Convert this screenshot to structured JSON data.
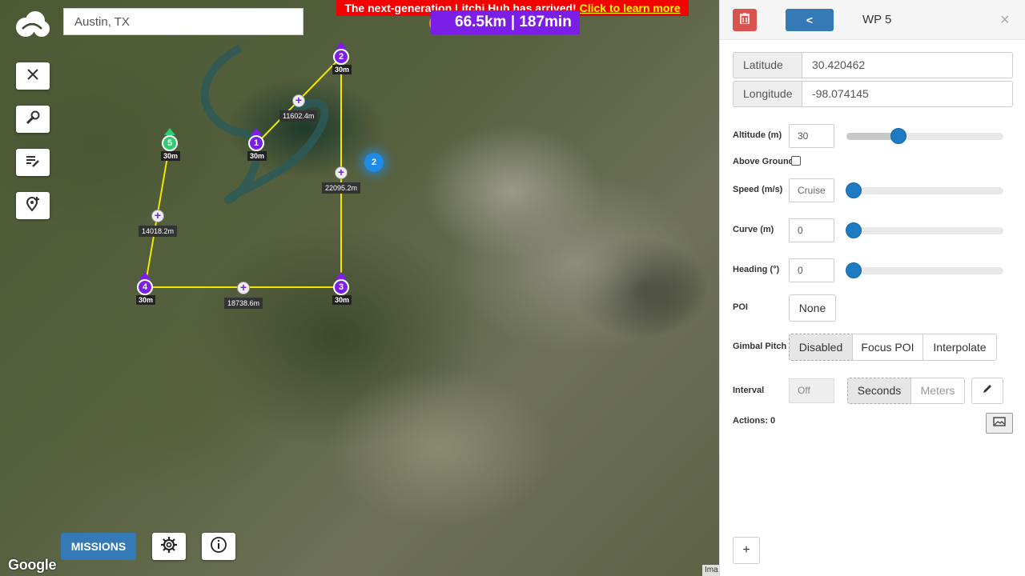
{
  "map": {
    "search_value": "Austin, TX",
    "banner_text": "The next-generation Litchi Hub has arrived! ",
    "banner_link": "Click to learn more",
    "stats": "66.5km | 187min",
    "missions_label": "MISSIONS",
    "google_label": "Google",
    "imagery_label": "Ima",
    "blue_marker": "2",
    "waypoints": [
      {
        "num": "1",
        "alt": "30m"
      },
      {
        "num": "2",
        "alt": "30m"
      },
      {
        "num": "3",
        "alt": "30m"
      },
      {
        "num": "4",
        "alt": "30m"
      },
      {
        "num": "5",
        "alt": "30m"
      }
    ],
    "distances": [
      "11602.4m",
      "22095.2m",
      "14018.2m",
      "18738.6m"
    ]
  },
  "panel": {
    "title": "WP 5",
    "back_label": "<",
    "close_label": "×",
    "latitude_label": "Latitude",
    "latitude_value": "30.420462",
    "longitude_label": "Longitude",
    "longitude_value": "-98.074145",
    "altitude_label": "Altitude (m)",
    "altitude_value": "30",
    "altitude_level": 0.33,
    "above_ground_label": "Above Ground",
    "speed_label": "Speed (m/s)",
    "speed_value": "Cruise",
    "curve_label": "Curve (m)",
    "curve_value": "0",
    "heading_label": "Heading (°)",
    "heading_value": "0",
    "poi_label": "POI",
    "poi_value": "None",
    "gimbal_label": "Gimbal Pitch",
    "gimbal_options": [
      "Disabled",
      "Focus POI",
      "Interpolate"
    ],
    "interval_label": "Interval",
    "interval_value": "Off",
    "interval_units": [
      "Seconds",
      "Meters"
    ],
    "actions_label": "Actions: 0",
    "add_label": "+"
  },
  "colors": {
    "waypoint": "#7b1fe8",
    "waypoint_selected": "#2ecc71",
    "path": "#f2e600",
    "delete": "#d9534f",
    "primary": "#337ab7",
    "slider": "#1e7bc2"
  }
}
